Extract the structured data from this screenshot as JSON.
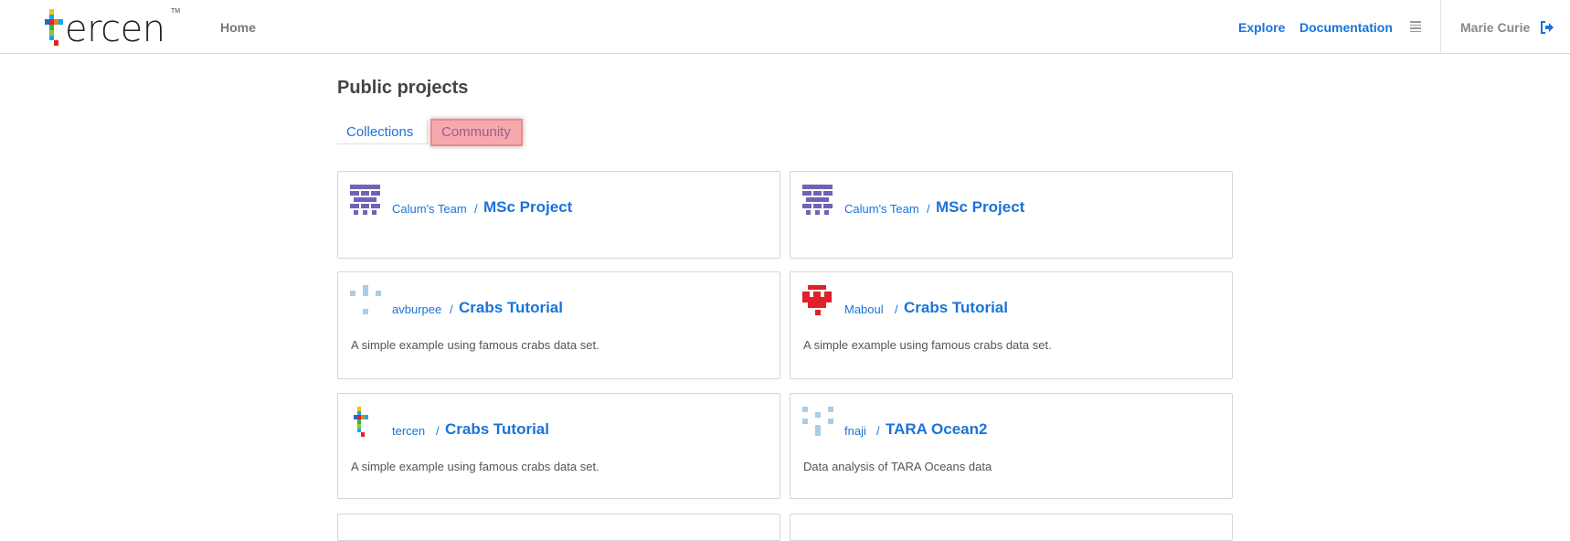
{
  "header": {
    "logo_text": "ercen",
    "logo_tm": "TM",
    "home_label": "Home",
    "explore_label": "Explore",
    "documentation_label": "Documentation",
    "user_name": "Marie Curie",
    "accent_color": "#1a73d9"
  },
  "main": {
    "title": "Public projects",
    "tabs": [
      {
        "label": "Collections",
        "active": false
      },
      {
        "label": "Community",
        "active": true
      }
    ],
    "projects": [
      {
        "owner": "Calum's Team",
        "separator": "/",
        "name": "MSc Project",
        "description": "",
        "avatar": "purple-invader-icon"
      },
      {
        "owner": "Calum's Team",
        "separator": "/",
        "name": "MSc Project",
        "description": "",
        "avatar": "purple-invader-icon"
      },
      {
        "owner": "avburpee",
        "separator": "/",
        "name": "Crabs Tutorial",
        "description": "A simple example using famous crabs data set.",
        "avatar": "lightblue-pixel-icon"
      },
      {
        "owner": "Maboul",
        "separator": "/",
        "name": "Crabs Tutorial",
        "description": "A simple example using famous crabs data set.",
        "avatar": "red-invader-icon"
      },
      {
        "owner": "tercen",
        "separator": "/",
        "name": "Crabs Tutorial",
        "description": "A simple example using famous crabs data set.",
        "avatar": "tercen-logo-icon"
      },
      {
        "owner": "fnaji",
        "separator": "/",
        "name": "TARA Ocean2",
        "description": "Data analysis of TARA Oceans data",
        "avatar": "lightblue-pixel-icon"
      }
    ]
  }
}
